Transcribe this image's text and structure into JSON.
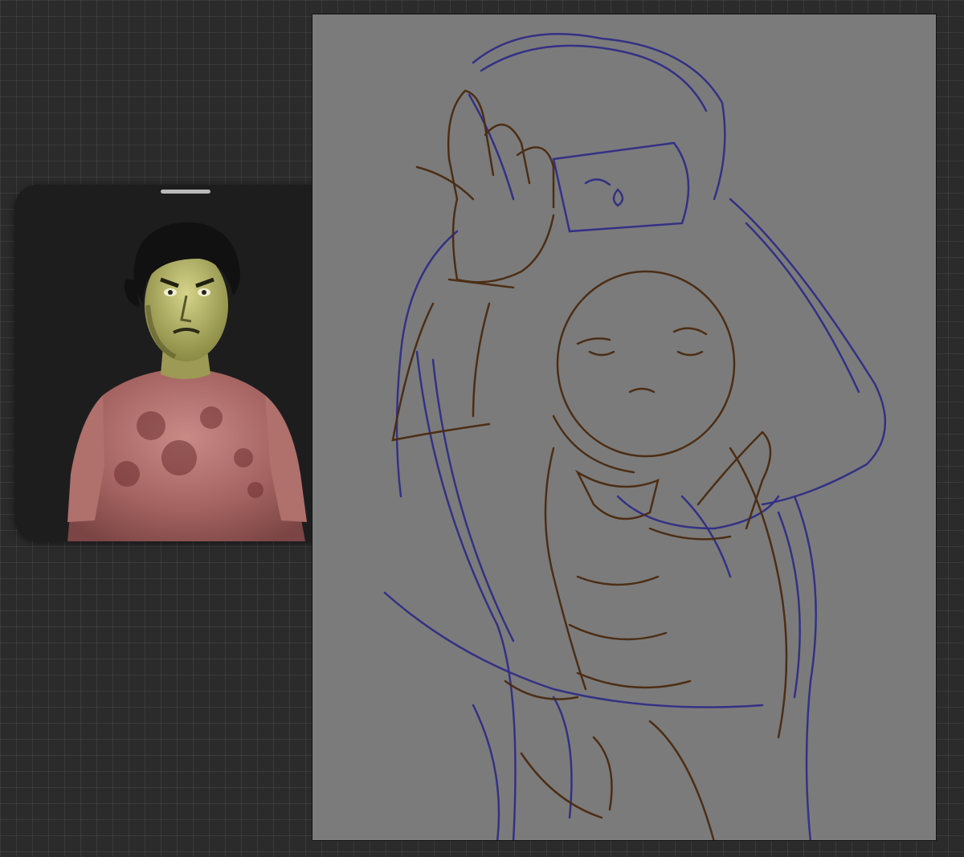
{
  "workspace": {
    "background_color": "#2b2b2c",
    "grid": true
  },
  "reference_window": {
    "handle": "drag-handle",
    "photo_icon": "reference-photo"
  },
  "canvas": {
    "paper_color": "#7b7b7b",
    "sketch_layers": [
      {
        "color": "#2c2a86"
      },
      {
        "color": "#4a2a10"
      }
    ]
  }
}
